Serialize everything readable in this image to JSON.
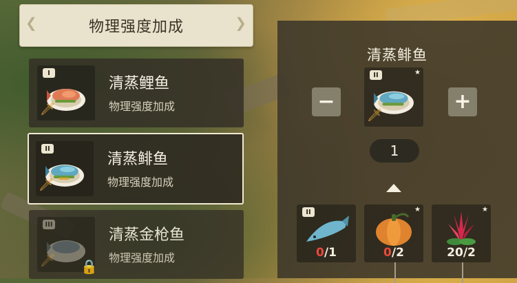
{
  "header": {
    "title": "物理强度加成"
  },
  "recipes": [
    {
      "tier": "I",
      "name": "清蒸鲤鱼",
      "effect": "物理强度加成",
      "selected": false,
      "locked": false
    },
    {
      "tier": "II",
      "name": "清蒸鲱鱼",
      "effect": "物理强度加成",
      "selected": true,
      "locked": false
    },
    {
      "tier": "III",
      "name": "清蒸金枪鱼",
      "effect": "物理强度加成",
      "selected": false,
      "locked": true
    }
  ],
  "detail": {
    "title": "清蒸鲱鱼",
    "tier": "II",
    "quantity": "1",
    "minus_label": "−",
    "plus_label": "+",
    "ingredients": [
      {
        "name": "fish",
        "tier": "II",
        "have": "0",
        "need": "/1"
      },
      {
        "name": "pumpkin",
        "have": "0",
        "need": "/2"
      },
      {
        "name": "red-herb",
        "have": "20",
        "need": "/2"
      }
    ]
  },
  "icons": {
    "sword": "sword-icon",
    "lock": "lock-icon",
    "star": "star-icon"
  },
  "colors": {
    "insufficient": "#e84a3c",
    "panel": "#3c372a",
    "selected_border": "#f1ead3"
  }
}
